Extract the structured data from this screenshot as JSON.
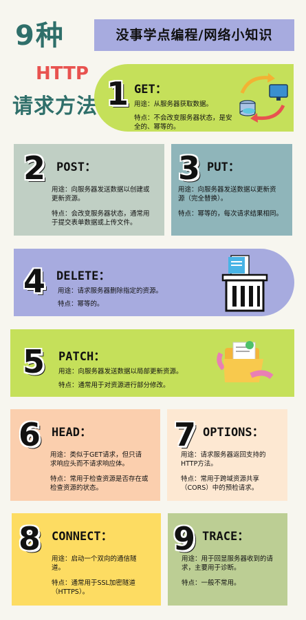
{
  "header": {
    "title_line1": "9种",
    "title_line2": "HTTP",
    "title_line3": "请求方法",
    "banner": "没事学点编程/网络小知识"
  },
  "methods": [
    {
      "num": "1",
      "name": "GET：",
      "usage": "用途：从服务器获取数据。",
      "feature_1": "特点：不会改变服务器状态，是安",
      "feature_2": "全的、幂等的。"
    },
    {
      "num": "2",
      "name": "POST：",
      "usage_1": "用途：向服务器发送数据以创建或",
      "usage_2": "更新资源。",
      "feature_1": "特点：会改变服务器状态，通常用",
      "feature_2": "于提交表单数据或上传文件。"
    },
    {
      "num": "3",
      "name": "PUT：",
      "usage_1": "用途：向服务器发送数据以更新资",
      "usage_2": "源（完全替换）。",
      "feature": "特点：幂等的，每次请求结果相同。"
    },
    {
      "num": "4",
      "name": "DELETE：",
      "usage": "用途：请求服务器删除指定的资源。",
      "feature": "特点：幂等的。"
    },
    {
      "num": "5",
      "name": "PATCH：",
      "usage": "用途：向服务器发送数据以局部更新资源。",
      "feature": "特点：通常用于对资源进行部分修改。"
    },
    {
      "num": "6",
      "name": "HEAD：",
      "usage_1": "用途：类似于GET请求，但只请",
      "usage_2": "求响应头而不请求响应体。",
      "feature_1": "特点：常用于检查资源是否存在或",
      "feature_2": "检查资源的状态。"
    },
    {
      "num": "7",
      "name": "OPTIONS：",
      "usage_1": "用途：请求服务器返回支持的",
      "usage_2": "HTTP方法。",
      "feature_1": "特点：常用于跨域资源共享",
      "feature_2": "（CORS）中的预检请求。"
    },
    {
      "num": "8",
      "name": "CONNECT：",
      "usage_1": "用途：启动一个双向的通信隧",
      "usage_2": "道。",
      "feature_1": "特点：通常用于SSL加密隧道",
      "feature_2": "（HTTPS）。"
    },
    {
      "num": "9",
      "name": "TRACE：",
      "usage_1": "用途：用于回显服务器收到的请",
      "usage_2": "求，主要用于诊断。",
      "feature": "特点：一般不常用。"
    }
  ]
}
